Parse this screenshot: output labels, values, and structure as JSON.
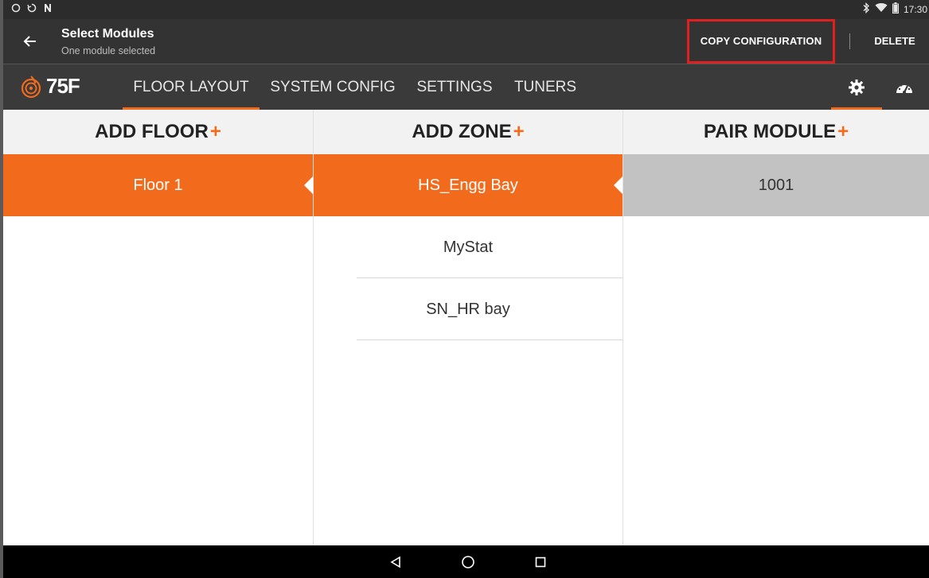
{
  "status_bar": {
    "left_icons": [
      "circle-outline-icon",
      "sync-icon",
      "n-badge-icon"
    ],
    "right_icons": [
      "bluetooth-icon",
      "wifi-icon",
      "battery-icon"
    ],
    "time": "17:30"
  },
  "action_bar": {
    "title": "Select Modules",
    "subtitle": "One module selected",
    "copy_label": "COPY CONFIGURATION",
    "delete_label": "DELETE"
  },
  "brand": {
    "logo_text": "75F"
  },
  "tabs": [
    {
      "label": "FLOOR LAYOUT",
      "active": true
    },
    {
      "label": "SYSTEM CONFIG",
      "active": false
    },
    {
      "label": "SETTINGS",
      "active": false
    },
    {
      "label": "TUNERS",
      "active": false
    }
  ],
  "columns": {
    "floors": {
      "header": "ADD FLOOR",
      "plus": "+",
      "items": [
        "Floor 1"
      ],
      "selected_index": 0
    },
    "zones": {
      "header": "ADD ZONE",
      "plus": "+",
      "items": [
        "HS_Engg Bay",
        "MyStat",
        "SN_HR bay"
      ],
      "selected_index": 0
    },
    "modules": {
      "header": "PAIR MODULE",
      "plus": "+",
      "items": [
        "1001"
      ],
      "selected_index": 0
    }
  },
  "colors": {
    "accent": "#f26b1d",
    "highlight_box": "#e0201f",
    "toolbar": "#333333",
    "tabbar": "#3a3a3a",
    "module_selected": "#c2c2c2"
  }
}
